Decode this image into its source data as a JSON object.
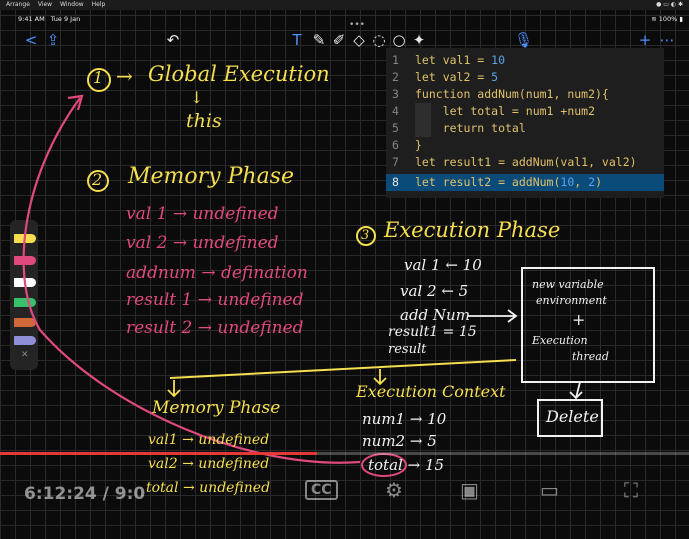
{
  "menubar": {
    "items": [
      "Arrange",
      "View",
      "Window",
      "Help"
    ]
  },
  "status": {
    "time": "9:41 AM",
    "date": "Tue 9 Jan",
    "battery": "100%"
  },
  "toolbar": {
    "back": "<",
    "share": "⇪",
    "undo": "↶",
    "text_tool": "T",
    "add": "+",
    "more": "⋯",
    "camera": "◎"
  },
  "code": {
    "lines": [
      {
        "n": "1",
        "t": "let val1 = 10"
      },
      {
        "n": "2",
        "t": "let val2 = 5"
      },
      {
        "n": "3",
        "t": "function addNum(num1, num2){"
      },
      {
        "n": "4",
        "t": "    let total = num1 +num2"
      },
      {
        "n": "5",
        "t": "    return total"
      },
      {
        "n": "6",
        "t": "}"
      },
      {
        "n": "7",
        "t": "let result1 = addNum(val1, val2)"
      },
      {
        "n": "8",
        "t": "let result2 = addNum(10, 2)"
      }
    ]
  },
  "notes": {
    "global": {
      "step": "1",
      "arrow": "→",
      "title": "Global Execution",
      "down": "↓",
      "this": "this"
    },
    "memory": {
      "step": "2",
      "title": "Memory Phase",
      "rows": [
        {
          "name": "val 1",
          "arrow": "→",
          "value": "undefined"
        },
        {
          "name": "val 2",
          "arrow": "→",
          "value": "undefined"
        },
        {
          "name": "addnum",
          "arrow": "→",
          "value": "defination"
        },
        {
          "name": "result 1",
          "arrow": "→",
          "value": "undefined"
        },
        {
          "name": "result 2",
          "arrow": "→",
          "value": "undefined"
        }
      ]
    },
    "execution": {
      "step": "3",
      "title": "Execution Phase",
      "rows": [
        {
          "name": "val 1",
          "arrow": "←",
          "value": "10"
        },
        {
          "name": "val 2",
          "arrow": "←",
          "value": "5"
        },
        {
          "name": "add Num",
          "arrow": "→",
          "value": ""
        },
        {
          "name": "result1 = 15",
          "arrow": "",
          "value": ""
        },
        {
          "name": "result",
          "arrow": "",
          "value": ""
        }
      ]
    },
    "box": {
      "line1": "new variable",
      "line2": "environment",
      "plus": "+",
      "line3": "Execution",
      "line4": "thread"
    },
    "delete": "Delete",
    "memory2": {
      "title": "Memory Phase",
      "rows": [
        {
          "name": "val1",
          "arrow": "→",
          "value": "undefined"
        },
        {
          "name": "val2",
          "arrow": "→",
          "value": "undefined"
        },
        {
          "name": "total",
          "arrow": "→",
          "value": "undefined"
        }
      ]
    },
    "context": {
      "title": "Execution Context",
      "rows": [
        {
          "name": "num1",
          "arrow": "→",
          "value": "10"
        },
        {
          "name": "num2",
          "arrow": "→",
          "value": "5"
        },
        {
          "name": "total",
          "arrow": "→",
          "value": "15"
        }
      ]
    }
  },
  "video": {
    "timecode": "6:12:24 / 9:0",
    "progress": 0.46,
    "played_color": "#e53935"
  },
  "colors": {
    "yellow": "#f5de4f",
    "pink": "#e0497e",
    "code_bg": "#1e1e1e",
    "highlight": "#0a4b7a"
  }
}
